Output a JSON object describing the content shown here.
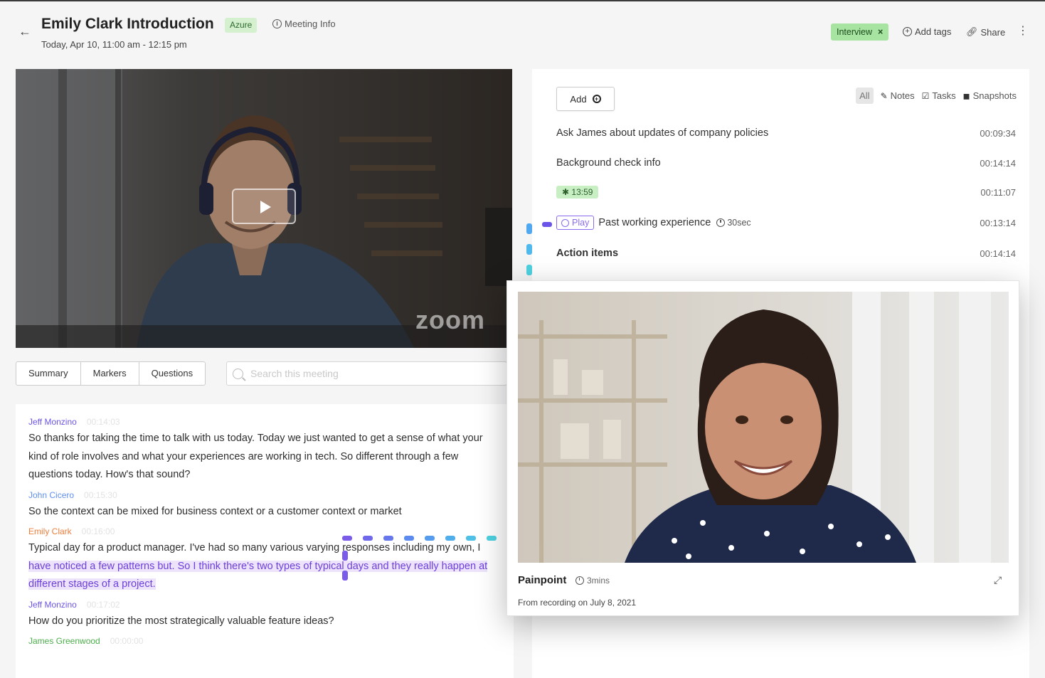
{
  "header": {
    "back_icon": "back-arrow-icon",
    "title": "Emily Clark Introduction",
    "badge": "Azure",
    "meeting_info": "Meeting Info",
    "subtitle": "Today, Apr 10, 11:00 am - 12:15 pm",
    "tag": "Interview",
    "add_tags": "Add tags",
    "share": "Share"
  },
  "video": {
    "watermark": "zoom"
  },
  "tabs": [
    {
      "label": "Summary"
    },
    {
      "label": "Markers"
    },
    {
      "label": "Questions"
    }
  ],
  "search": {
    "placeholder": "Search this meeting"
  },
  "transcript": [
    {
      "speaker": "Jeff Monzino",
      "time": "00:14:03",
      "color": "#6a55e8",
      "text": "So thanks for taking the time to talk with us today. Today we just wanted to get a sense of what your kind of role involves and what your experiences are working in tech. So different through a few questions today. How's that sound?"
    },
    {
      "speaker": "John Cicero",
      "time": "00:15:30",
      "color": "#5f8ff0",
      "text": "So the context can be mixed for business context or a customer context or market"
    },
    {
      "speaker": "Emily Clark",
      "time": "00:16:00",
      "color": "#ef7d3c",
      "text_before": "Typical day for a product manager. I've had so many various varying responses including my own, I ",
      "highlight": "have noticed a few patterns but. So I think there's two types of typical days and they really happen at different stages of a project."
    },
    {
      "speaker": "Jeff Monzino",
      "time": "00:17:02",
      "color": "#6a55e8",
      "text": "How do you prioritize the most strategically valuable feature ideas?"
    },
    {
      "speaker": "James Greenwood",
      "time": "00:00:00",
      "color": "#4cae4c"
    }
  ],
  "notes_panel": {
    "add_label": "Add",
    "filters": {
      "all": "All",
      "notes": "Notes",
      "tasks": "Tasks",
      "snapshots": "Snapshots"
    },
    "items": [
      {
        "text": "Ask James about updates of company policies",
        "time": "00:09:34"
      },
      {
        "text": "Background check info",
        "time": "00:14:14"
      },
      {
        "chip": "13:59",
        "time": "00:11:07"
      },
      {
        "play": "Play",
        "text": "Past working experience",
        "duration": "30sec",
        "time": "00:13:14"
      },
      {
        "text": "Action items",
        "time": "00:14:14"
      }
    ]
  },
  "popup": {
    "title": "Painpoint",
    "duration": "3mins",
    "subtitle": "From recording on July 8, 2021"
  },
  "colors": {
    "accent_purple": "#8a6bf0",
    "connector_cyan": "#4fd1e0",
    "tag_green": "#a7e3a1"
  }
}
